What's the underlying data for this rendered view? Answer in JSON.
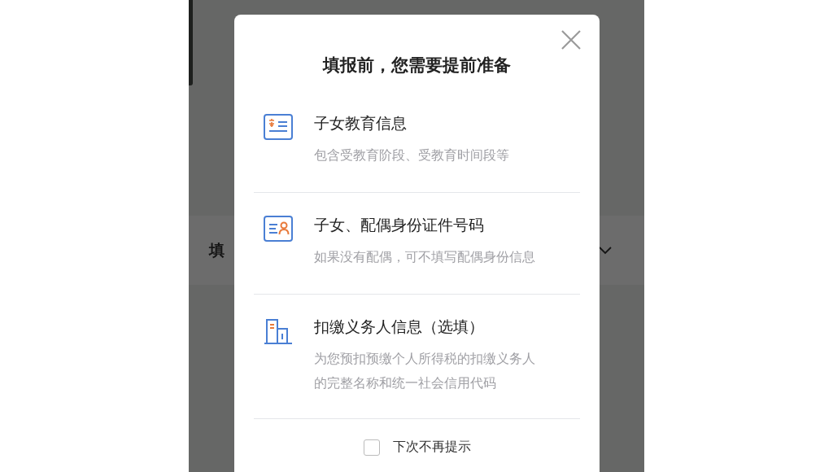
{
  "background": {
    "row_label": "填"
  },
  "dialog": {
    "title": "填报前，您需要提前准备",
    "items": [
      {
        "kind": "education",
        "title": "子女教育信息",
        "description": "包含受教育阶段、受教育时间段等"
      },
      {
        "kind": "id",
        "title": "子女、配偶身份证件号码",
        "description": "如果没有配偶，可不填写配偶身份信息"
      },
      {
        "kind": "employer",
        "title": "扣缴义务人信息（选填）",
        "description": "为您预扣预缴个人所得税的扣缴义务人的完整名称和统一社会信用代码"
      }
    ],
    "dont_show_again": {
      "label": "下次不再提示",
      "checked": false
    }
  }
}
